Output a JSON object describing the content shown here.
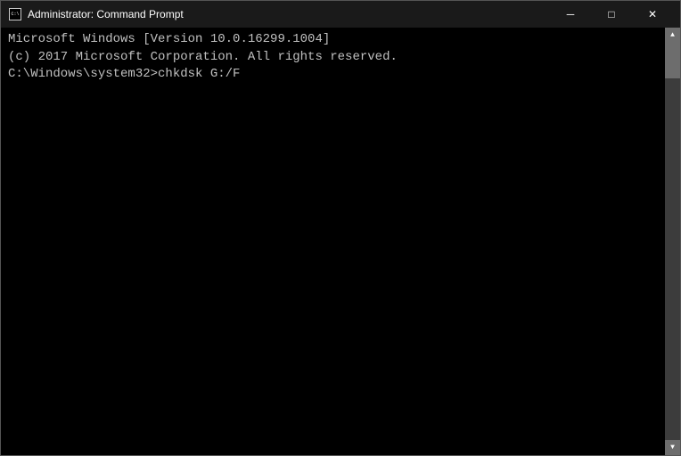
{
  "titleBar": {
    "title": "Administrator: Command Prompt",
    "iconLabel": "cmd-icon"
  },
  "controls": {
    "minimize": "─",
    "maximize": "□",
    "close": "✕"
  },
  "console": {
    "lines": [
      "Microsoft Windows [Version 10.0.16299.1004]",
      "(c) 2017 Microsoft Corporation. All rights reserved.",
      "",
      "C:\\Windows\\system32>chkdsk G:/F"
    ]
  }
}
